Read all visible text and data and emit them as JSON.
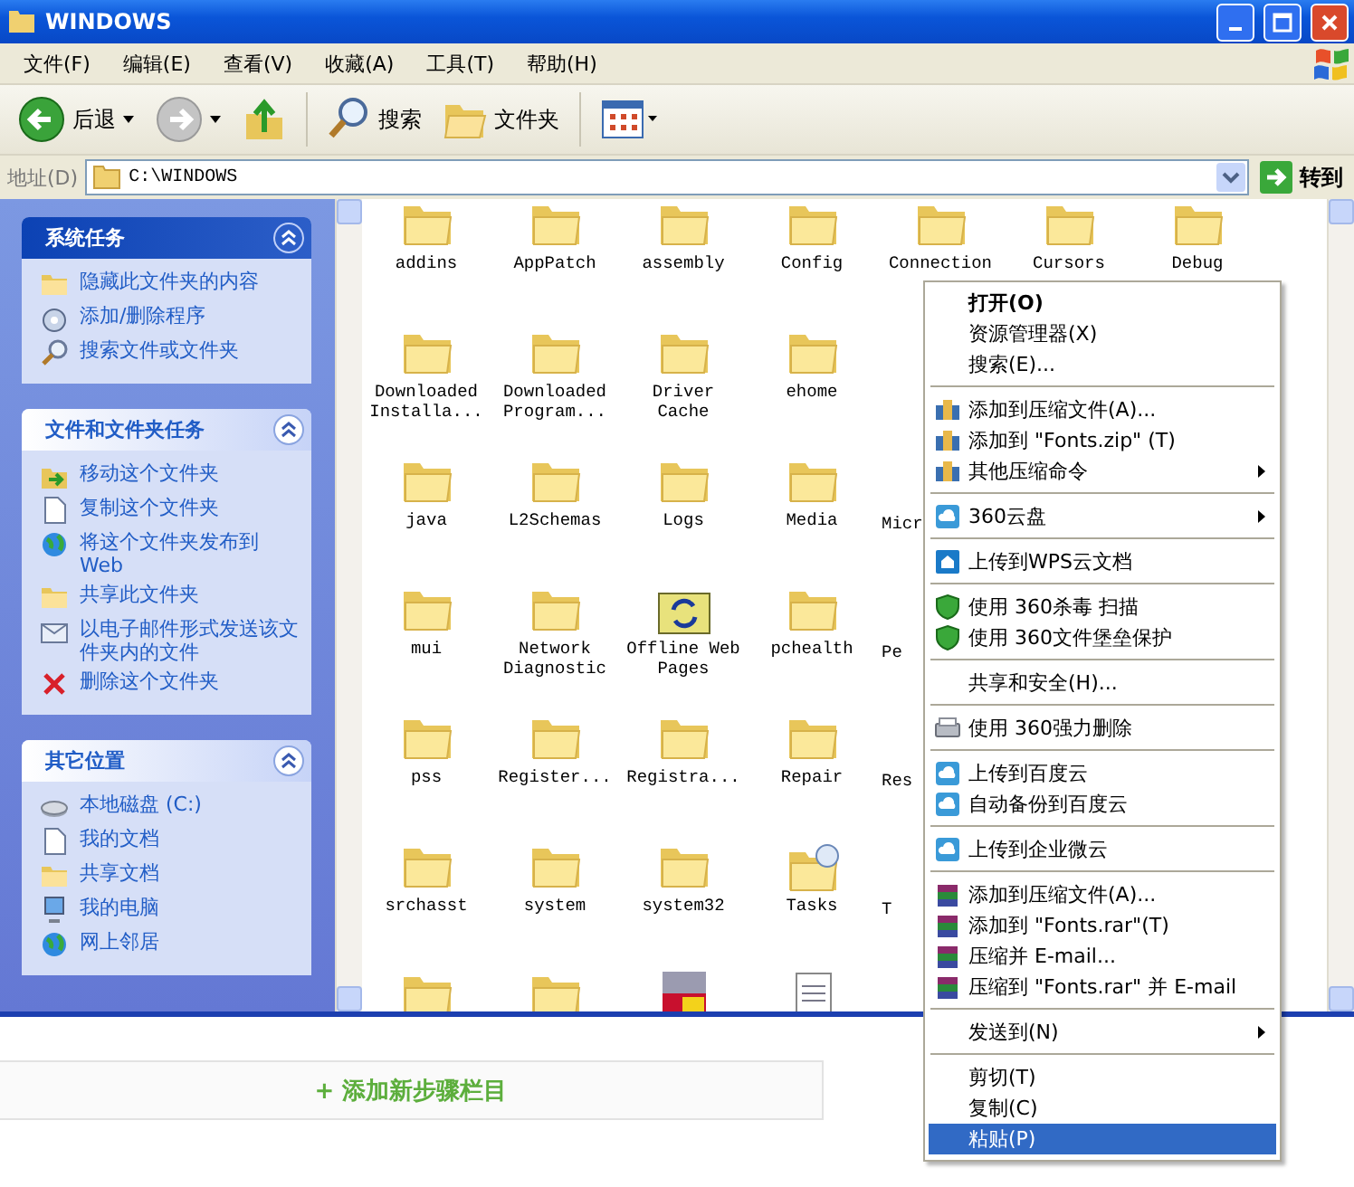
{
  "window": {
    "title": "WINDOWS"
  },
  "menu_bar": [
    "文件(F)",
    "编辑(E)",
    "查看(V)",
    "收藏(A)",
    "工具(T)",
    "帮助(H)"
  ],
  "toolbar": [
    {
      "kind": "back",
      "label": "后退"
    },
    {
      "kind": "forward"
    },
    {
      "kind": "up"
    },
    {
      "kind": "search",
      "label": "搜索"
    },
    {
      "kind": "folders",
      "label": "文件夹"
    },
    {
      "kind": "views"
    }
  ],
  "address_bar": {
    "label": "地址(D)",
    "value": "C:\\WINDOWS",
    "go_label": "转到"
  },
  "task_pane": [
    {
      "title": "系统任务",
      "selected": true,
      "items": [
        {
          "label": "隐藏此文件夹的内容",
          "kind": "folder"
        },
        {
          "label": "添加/删除程序",
          "kind": "cd"
        },
        {
          "label": "搜索文件或文件夹",
          "kind": "search"
        }
      ]
    },
    {
      "title": "文件和文件夹任务",
      "selected": false,
      "items": [
        {
          "label": "移动这个文件夹",
          "kind": "move"
        },
        {
          "label": "复制这个文件夹",
          "kind": "page"
        },
        {
          "label": "将这个文件夹发布到 Web",
          "kind": "globe"
        },
        {
          "label": "共享此文件夹",
          "kind": "folder"
        },
        {
          "label": "以电子邮件形式发送该文件夹内的文件",
          "kind": "mail"
        },
        {
          "label": "删除这个文件夹",
          "kind": "delete"
        }
      ]
    },
    {
      "title": "其它位置",
      "selected": false,
      "items": [
        {
          "label": "本地磁盘 (C:)",
          "kind": "disk"
        },
        {
          "label": "我的文档",
          "kind": "page"
        },
        {
          "label": "共享文档",
          "kind": "folder"
        },
        {
          "label": "我的电脑",
          "kind": "computer"
        },
        {
          "label": "网上邻居",
          "kind": "globe"
        }
      ]
    }
  ],
  "files": [
    [
      {
        "name": "addins",
        "kind": "folder"
      },
      {
        "name": "AppPatch",
        "kind": "folder"
      },
      {
        "name": "assembly",
        "kind": "folder"
      },
      {
        "name": "Config",
        "kind": "folder"
      },
      {
        "name": "Connection",
        "kind": "folder"
      },
      {
        "name": "Cursors",
        "kind": "folder"
      },
      {
        "name": "Debug",
        "kind": "folder"
      }
    ],
    [
      {
        "name": "Downloaded Installa...",
        "kind": "folder"
      },
      {
        "name": "Downloaded Program...",
        "kind": "folder"
      },
      {
        "name": "Driver Cache",
        "kind": "folder"
      },
      {
        "name": "ehome",
        "kind": "folder"
      }
    ],
    [
      {
        "name": "java",
        "kind": "folder"
      },
      {
        "name": "L2Schemas",
        "kind": "folder"
      },
      {
        "name": "Logs",
        "kind": "folder"
      },
      {
        "name": "Media",
        "kind": "folder"
      },
      {
        "name": "Micr"
      }
    ],
    [
      {
        "name": "mui",
        "kind": "folder"
      },
      {
        "name": "Network Diagnostic",
        "kind": "folder"
      },
      {
        "name": "Offline Web Pages",
        "kind": "offline"
      },
      {
        "name": "pchealth",
        "kind": "folder"
      },
      {
        "name": "Pe"
      }
    ],
    [
      {
        "name": "pss",
        "kind": "folder"
      },
      {
        "name": "Register...",
        "kind": "folder"
      },
      {
        "name": "Registra...",
        "kind": "folder"
      },
      {
        "name": "Repair",
        "kind": "folder"
      },
      {
        "name": "Res"
      }
    ],
    [
      {
        "name": "srchasst",
        "kind": "folder"
      },
      {
        "name": "system",
        "kind": "folder"
      },
      {
        "name": "system32",
        "kind": "folder"
      },
      {
        "name": "Tasks",
        "kind": "tasks"
      },
      {
        "name": "T"
      }
    ],
    [
      {
        "kind": "folder"
      },
      {
        "kind": "folder"
      },
      {
        "kind": "setup"
      },
      {
        "kind": "text"
      }
    ]
  ],
  "context_menu": [
    {
      "kind": "plain",
      "label": "打开(O)",
      "bold": true
    },
    {
      "kind": "plain",
      "label": "资源管理器(X)"
    },
    {
      "kind": "plain",
      "label": "搜索(E)..."
    },
    {
      "kind": "separator"
    },
    {
      "kind": "zip",
      "label": "添加到压缩文件(A)..."
    },
    {
      "kind": "zip",
      "label": "添加到 \"Fonts.zip\" (T)"
    },
    {
      "kind": "zip",
      "label": "其他压缩命令",
      "submenu": true
    },
    {
      "kind": "separator"
    },
    {
      "kind": "cloud",
      "label": "360云盘",
      "submenu": true
    },
    {
      "kind": "separator"
    },
    {
      "kind": "wps",
      "label": "上传到WPS云文档"
    },
    {
      "kind": "separator"
    },
    {
      "kind": "shield",
      "label": "使用 360杀毒 扫描"
    },
    {
      "kind": "shield",
      "label": "使用 360文件堡垒保护"
    },
    {
      "kind": "separator"
    },
    {
      "kind": "plain",
      "label": "共享和安全(H)..."
    },
    {
      "kind": "separator"
    },
    {
      "kind": "shredder",
      "label": "使用 360强力删除"
    },
    {
      "kind": "separator"
    },
    {
      "kind": "cloud",
      "label": "上传到百度云"
    },
    {
      "kind": "cloud",
      "label": "自动备份到百度云"
    },
    {
      "kind": "separator"
    },
    {
      "kind": "cloud",
      "label": "上传到企业微云"
    },
    {
      "kind": "separator"
    },
    {
      "kind": "rar",
      "label": "添加到压缩文件(A)..."
    },
    {
      "kind": "rar",
      "label": "添加到 \"Fonts.rar\"(T)"
    },
    {
      "kind": "rar",
      "label": "压缩并 E-mail..."
    },
    {
      "kind": "rar",
      "label": "压缩到 \"Fonts.rar\" 并 E-mail"
    },
    {
      "kind": "separator"
    },
    {
      "kind": "plain",
      "label": "发送到(N)",
      "submenu": true
    },
    {
      "kind": "separator"
    },
    {
      "kind": "plain",
      "label": "剪切(T)"
    },
    {
      "kind": "plain",
      "label": "复制(C)"
    },
    {
      "kind": "plain",
      "label": "粘贴(P)",
      "selected": true
    }
  ],
  "add_step_button": "+ 添加新步骤栏目"
}
